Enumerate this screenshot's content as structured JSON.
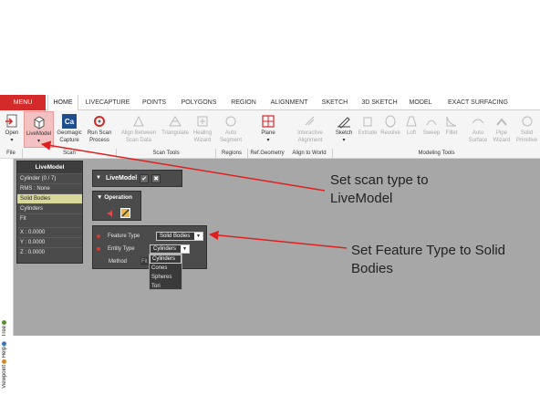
{
  "menubar": {
    "menu_label": "MENU",
    "tabs": [
      "HOME",
      "LIVECAPTURE",
      "POINTS",
      "POLYGONS",
      "REGION",
      "ALIGNMENT",
      "SKETCH",
      "3D SKETCH",
      "MODEL",
      "EXACT SURFACING"
    ],
    "active_tab": "HOME"
  },
  "ribbon": {
    "tools": {
      "open": "Open",
      "livemodel": "LiveModel",
      "geomagic_capture_1": "Geomagic",
      "geomagic_capture_2": "Capture",
      "geomagic_icon_text": "Ca",
      "run_scan_1": "Run Scan",
      "run_scan_2": "Process",
      "align_1": "Align Between",
      "align_2": "Scan Data",
      "triangulate": "Triangulate",
      "healing_1": "Healing",
      "healing_2": "Wizard",
      "auto_segment_1": "Auto",
      "auto_segment_2": "Segment",
      "plane": "Plane",
      "interactive_1": "Interactive",
      "interactive_2": "Alignment",
      "sketch": "Sketch",
      "extrude": "Extrude",
      "revolve": "Revolve",
      "loft": "Loft",
      "sweep": "Sweep",
      "fillet": "Fillet",
      "auto_surface_1": "Auto",
      "auto_surface_2": "Surface",
      "pipe_wizard_1": "Pipe",
      "pipe_wizard_2": "Wizard",
      "solid_primitive_1": "Solid",
      "solid_primitive_2": "Primitive"
    },
    "groups": {
      "file": "File",
      "scan": "Scan",
      "scan_tools": "Scan Tools",
      "regions": "Regions",
      "ref_geometry": "Ref.Geometry",
      "align_to_world": "Align to World",
      "modeling_tools": "Modeling Tools"
    }
  },
  "side_tabs": {
    "tree": "Tree",
    "help": "Help",
    "viewpoint": "Viewpoint"
  },
  "livemodel_panel": {
    "title": "LiveModel",
    "rows": [
      "Cylinder  (0 / 7)",
      "RMS : None",
      "Solid Bodies",
      "Cylinders",
      "Fit"
    ],
    "selected_row": "Solid Bodies",
    "coords": [
      "X : 0.0000",
      "Y : 0.0000",
      "Z : 0.0000"
    ]
  },
  "livemodel_header": {
    "title": "LiveModel",
    "ok": "✔",
    "cancel": "✖"
  },
  "operation": {
    "title": "Operation"
  },
  "feature": {
    "feature_type_label": "Feature Type",
    "feature_type_value": "Solid Bodies",
    "entity_type_label": "Entity Type",
    "entity_type_value": "Cylinders",
    "method_label": "Method",
    "method_value": "Fit",
    "dropdown_options": [
      "Cylinders",
      "Cones",
      "Spheres",
      "Tori"
    ],
    "dropdown_selected": "Cylinders"
  },
  "callouts": {
    "scan_type_1": "Set scan type to",
    "scan_type_2": "LiveModel",
    "feature_type_1": "Set Feature Type to Solid",
    "feature_type_2": "Bodies"
  },
  "colors": {
    "accent_red": "#d42a2a",
    "arrow_red": "#e02020",
    "workspace_gray": "#a7a7a7",
    "panel_dark": "#4b4b4b",
    "selection_yellow": "#d8d89a"
  }
}
